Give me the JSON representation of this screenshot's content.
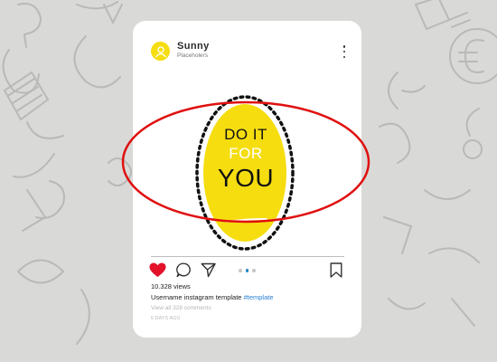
{
  "post": {
    "username": "Sunny",
    "subtitle": "Placeholers",
    "image_text": {
      "line1": "DO IT",
      "line2": "FOR",
      "line3": "YOU"
    },
    "views": "10.328 views",
    "caption_user": "Username",
    "caption_text": " instagram template ",
    "caption_tag": "#template",
    "comments_link": "View all 328 comments",
    "date": "6 DAYS AGO",
    "carousel": {
      "count": 3,
      "active_index": 1
    }
  },
  "icons": {
    "more": "more-vertical-icon",
    "like": "heart-icon",
    "comment": "comment-icon",
    "share": "send-icon",
    "save": "bookmark-icon",
    "avatar": "user-icon"
  },
  "colors": {
    "background": "#d9d9d7",
    "accent_yellow": "#f6dd10",
    "heart": "#e3122a",
    "hashtag": "#2a7fd0",
    "highlight_ellipse": "#e01010"
  }
}
